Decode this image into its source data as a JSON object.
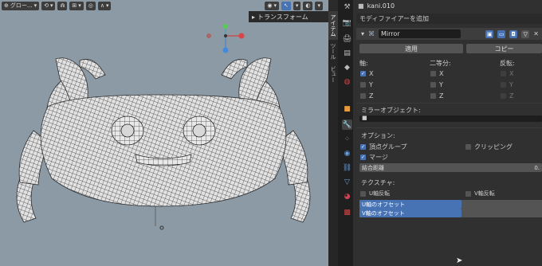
{
  "viewport": {
    "mode_label": "グロー...",
    "transform_panel": "トランスフォーム"
  },
  "n_tabs": [
    "アイテム",
    "ツール",
    "ビュー"
  ],
  "object_name": "kani.010",
  "add_modifier": "モディファイアーを追加",
  "modifier": {
    "name": "Mirror",
    "apply": "適用",
    "copy": "コピー",
    "axis_label": "軸:",
    "bisect_label": "二等分:",
    "flip_label": "反転:",
    "axes": [
      "X",
      "Y",
      "Z"
    ],
    "axis_checked": [
      true,
      false,
      false
    ],
    "bisect_checked": [
      false,
      false,
      false
    ],
    "flip_checked": [
      false,
      false,
      false
    ],
    "mirror_object_label": "ミラーオブジェクト:",
    "options_label": "オプション:",
    "vertex_groups": "頂点グループ",
    "vertex_groups_checked": true,
    "clipping": "クリッピング",
    "clipping_checked": false,
    "merge": "マージ",
    "merge_checked": true,
    "merge_distance_label": "結合距離",
    "merge_distance_value": "0.",
    "textures_label": "テクスチャ:",
    "u_flip": "U軸反転",
    "v_flip": "V軸反転",
    "u_offset": "U軸のオフセット",
    "v_offset": "V軸のオフセット",
    "u_offset_fill": 0.56,
    "v_offset_fill": 0.56
  }
}
